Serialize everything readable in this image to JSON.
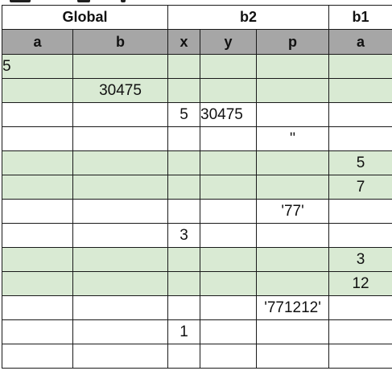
{
  "groups": [
    {
      "label": "Global"
    },
    {
      "label": "b2"
    },
    {
      "label": "b1"
    }
  ],
  "columns": [
    {
      "label": "a"
    },
    {
      "label": "b"
    },
    {
      "label": "x"
    },
    {
      "label": "y"
    },
    {
      "label": "p"
    },
    {
      "label": "a"
    }
  ],
  "rows": [
    {
      "cells": [
        "5",
        "",
        "",
        "",
        "",
        ""
      ]
    },
    {
      "cells": [
        "",
        "30475",
        "",
        "",
        "",
        ""
      ]
    },
    {
      "cells": [
        "",
        "",
        "5",
        "30475",
        "",
        ""
      ]
    },
    {
      "cells": [
        "",
        "",
        "",
        "",
        "''",
        ""
      ]
    },
    {
      "cells": [
        "",
        "",
        "",
        "",
        "",
        "5"
      ]
    },
    {
      "cells": [
        "",
        "",
        "",
        "",
        "",
        "7"
      ]
    },
    {
      "cells": [
        "",
        "",
        "",
        "",
        "'77'",
        ""
      ]
    },
    {
      "cells": [
        "",
        "",
        "3",
        "",
        "",
        ""
      ]
    },
    {
      "cells": [
        "",
        "",
        "",
        "",
        "",
        "3"
      ]
    },
    {
      "cells": [
        "",
        "",
        "",
        "",
        "",
        "12"
      ]
    },
    {
      "cells": [
        "",
        "",
        "",
        "",
        "'771212'",
        ""
      ]
    },
    {
      "cells": [
        "",
        "",
        "1",
        "",
        "",
        ""
      ]
    },
    {
      "cells": [
        "",
        "",
        "",
        "",
        "",
        ""
      ]
    }
  ],
  "colors": {
    "header_fill": "#a6a6a6",
    "row_highlight": "#d9ead3",
    "grid_line": "#1a1a1a"
  }
}
